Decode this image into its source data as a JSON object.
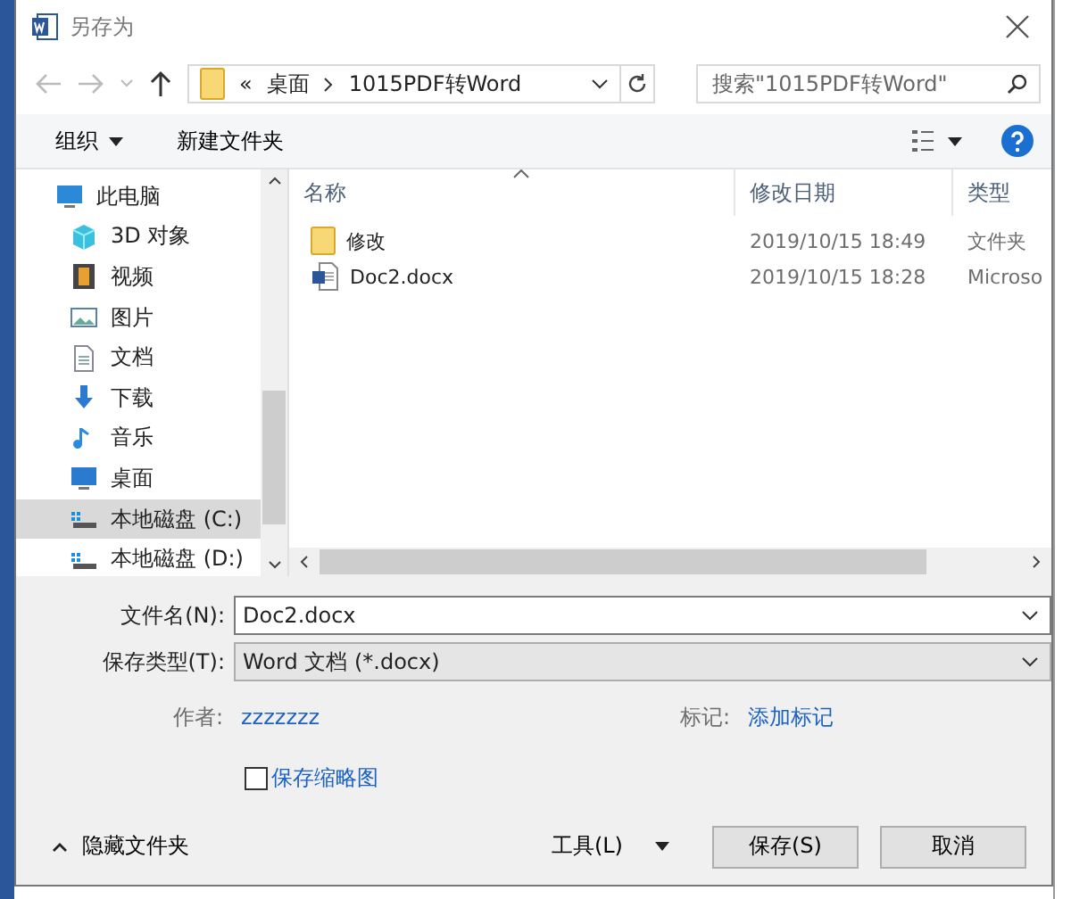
{
  "window": {
    "title": "另存为"
  },
  "address": {
    "overflow": "«",
    "segments": [
      "桌面",
      "1015PDF转Word"
    ]
  },
  "search": {
    "placeholder": "搜索\"1015PDF转Word\""
  },
  "toolbar": {
    "organize": "组织",
    "new_folder": "新建文件夹"
  },
  "sidebar": {
    "items": [
      {
        "label": "此电脑",
        "kind": "pc",
        "selected": false
      },
      {
        "label": "3D 对象",
        "kind": "cube",
        "selected": false
      },
      {
        "label": "视频",
        "kind": "video",
        "selected": false
      },
      {
        "label": "图片",
        "kind": "pictures",
        "selected": false
      },
      {
        "label": "文档",
        "kind": "docs",
        "selected": false
      },
      {
        "label": "下载",
        "kind": "download",
        "selected": false
      },
      {
        "label": "音乐",
        "kind": "music",
        "selected": false
      },
      {
        "label": "桌面",
        "kind": "desktop",
        "selected": false
      },
      {
        "label": "本地磁盘 (C:)",
        "kind": "drive",
        "selected": true
      },
      {
        "label": "本地磁盘 (D:)",
        "kind": "drive",
        "selected": false
      }
    ]
  },
  "table": {
    "columns": [
      {
        "label": "名称",
        "sorted": true
      },
      {
        "label": "修改日期",
        "sorted": false
      },
      {
        "label": "类型",
        "sorted": false
      }
    ],
    "rows": [
      {
        "name": "修改",
        "kind": "folder",
        "modified": "2019/10/15 18:49",
        "type": "文件夹"
      },
      {
        "name": "Doc2.docx",
        "kind": "word",
        "modified": "2019/10/15 18:28",
        "type": "Microso"
      }
    ]
  },
  "form": {
    "filename": {
      "label": "文件名(N):",
      "value": "Doc2.docx"
    },
    "filetype": {
      "label": "保存类型(T):",
      "value": "Word 文档 (*.docx)"
    },
    "author": {
      "label": "作者:",
      "value": "zzzzzzz"
    },
    "tags": {
      "label": "标记:",
      "value": "添加标记"
    },
    "thumbnail": {
      "label": "保存缩略图",
      "checked": false
    }
  },
  "footer": {
    "hide_folders": "隐藏文件夹",
    "tools": "工具(L)",
    "save": "保存(S)",
    "cancel": "取消"
  }
}
